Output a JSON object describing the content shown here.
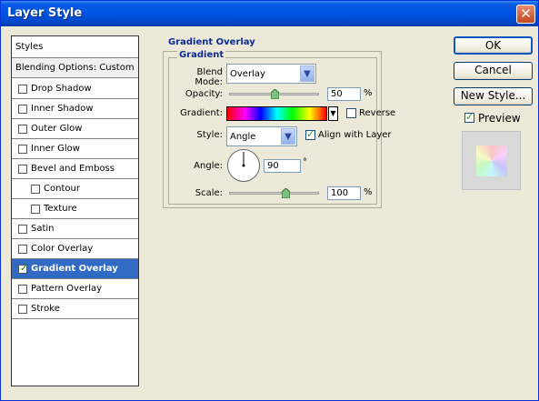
{
  "window": {
    "title": "Layer Style",
    "close_glyph": "✕"
  },
  "styles_list": {
    "header": "Styles",
    "blending_options": "Blending Options: Custom",
    "items": [
      {
        "label": "Drop Shadow",
        "checked": false
      },
      {
        "label": "Inner Shadow",
        "checked": false
      },
      {
        "label": "Outer Glow",
        "checked": false
      },
      {
        "label": "Inner Glow",
        "checked": false
      },
      {
        "label": "Bevel and Emboss",
        "checked": false
      },
      {
        "label": "Contour",
        "checked": false,
        "sub": true
      },
      {
        "label": "Texture",
        "checked": false,
        "sub": true
      },
      {
        "label": "Satin",
        "checked": false
      },
      {
        "label": "Color Overlay",
        "checked": false
      },
      {
        "label": "Gradient Overlay",
        "checked": true,
        "selected": true
      },
      {
        "label": "Pattern Overlay",
        "checked": false
      },
      {
        "label": "Stroke",
        "checked": false
      }
    ]
  },
  "panel": {
    "group_title": "Gradient Overlay",
    "subgroup_title": "Gradient",
    "blend_mode_label": "Blend Mode:",
    "blend_mode_value": "Overlay",
    "opacity_label": "Opacity:",
    "opacity_value": "50",
    "opacity_unit": "%",
    "opacity_level": 0.5,
    "gradient_label": "Gradient:",
    "reverse_label": "Reverse",
    "reverse_checked": false,
    "style_label": "Style:",
    "style_value": "Angle",
    "align_label": "Align with Layer",
    "align_checked": true,
    "angle_label": "Angle:",
    "angle_value": "90",
    "angle_unit": "°",
    "scale_label": "Scale:",
    "scale_value": "100",
    "scale_unit": "%"
  },
  "buttons": {
    "ok": "OK",
    "cancel": "Cancel",
    "new_style": "New Style..."
  },
  "preview": {
    "label": "Preview",
    "checked": true
  },
  "colors": {
    "title_bar": "#0054e3",
    "selection": "#316ac5",
    "section_title": "#0a2a9a"
  }
}
